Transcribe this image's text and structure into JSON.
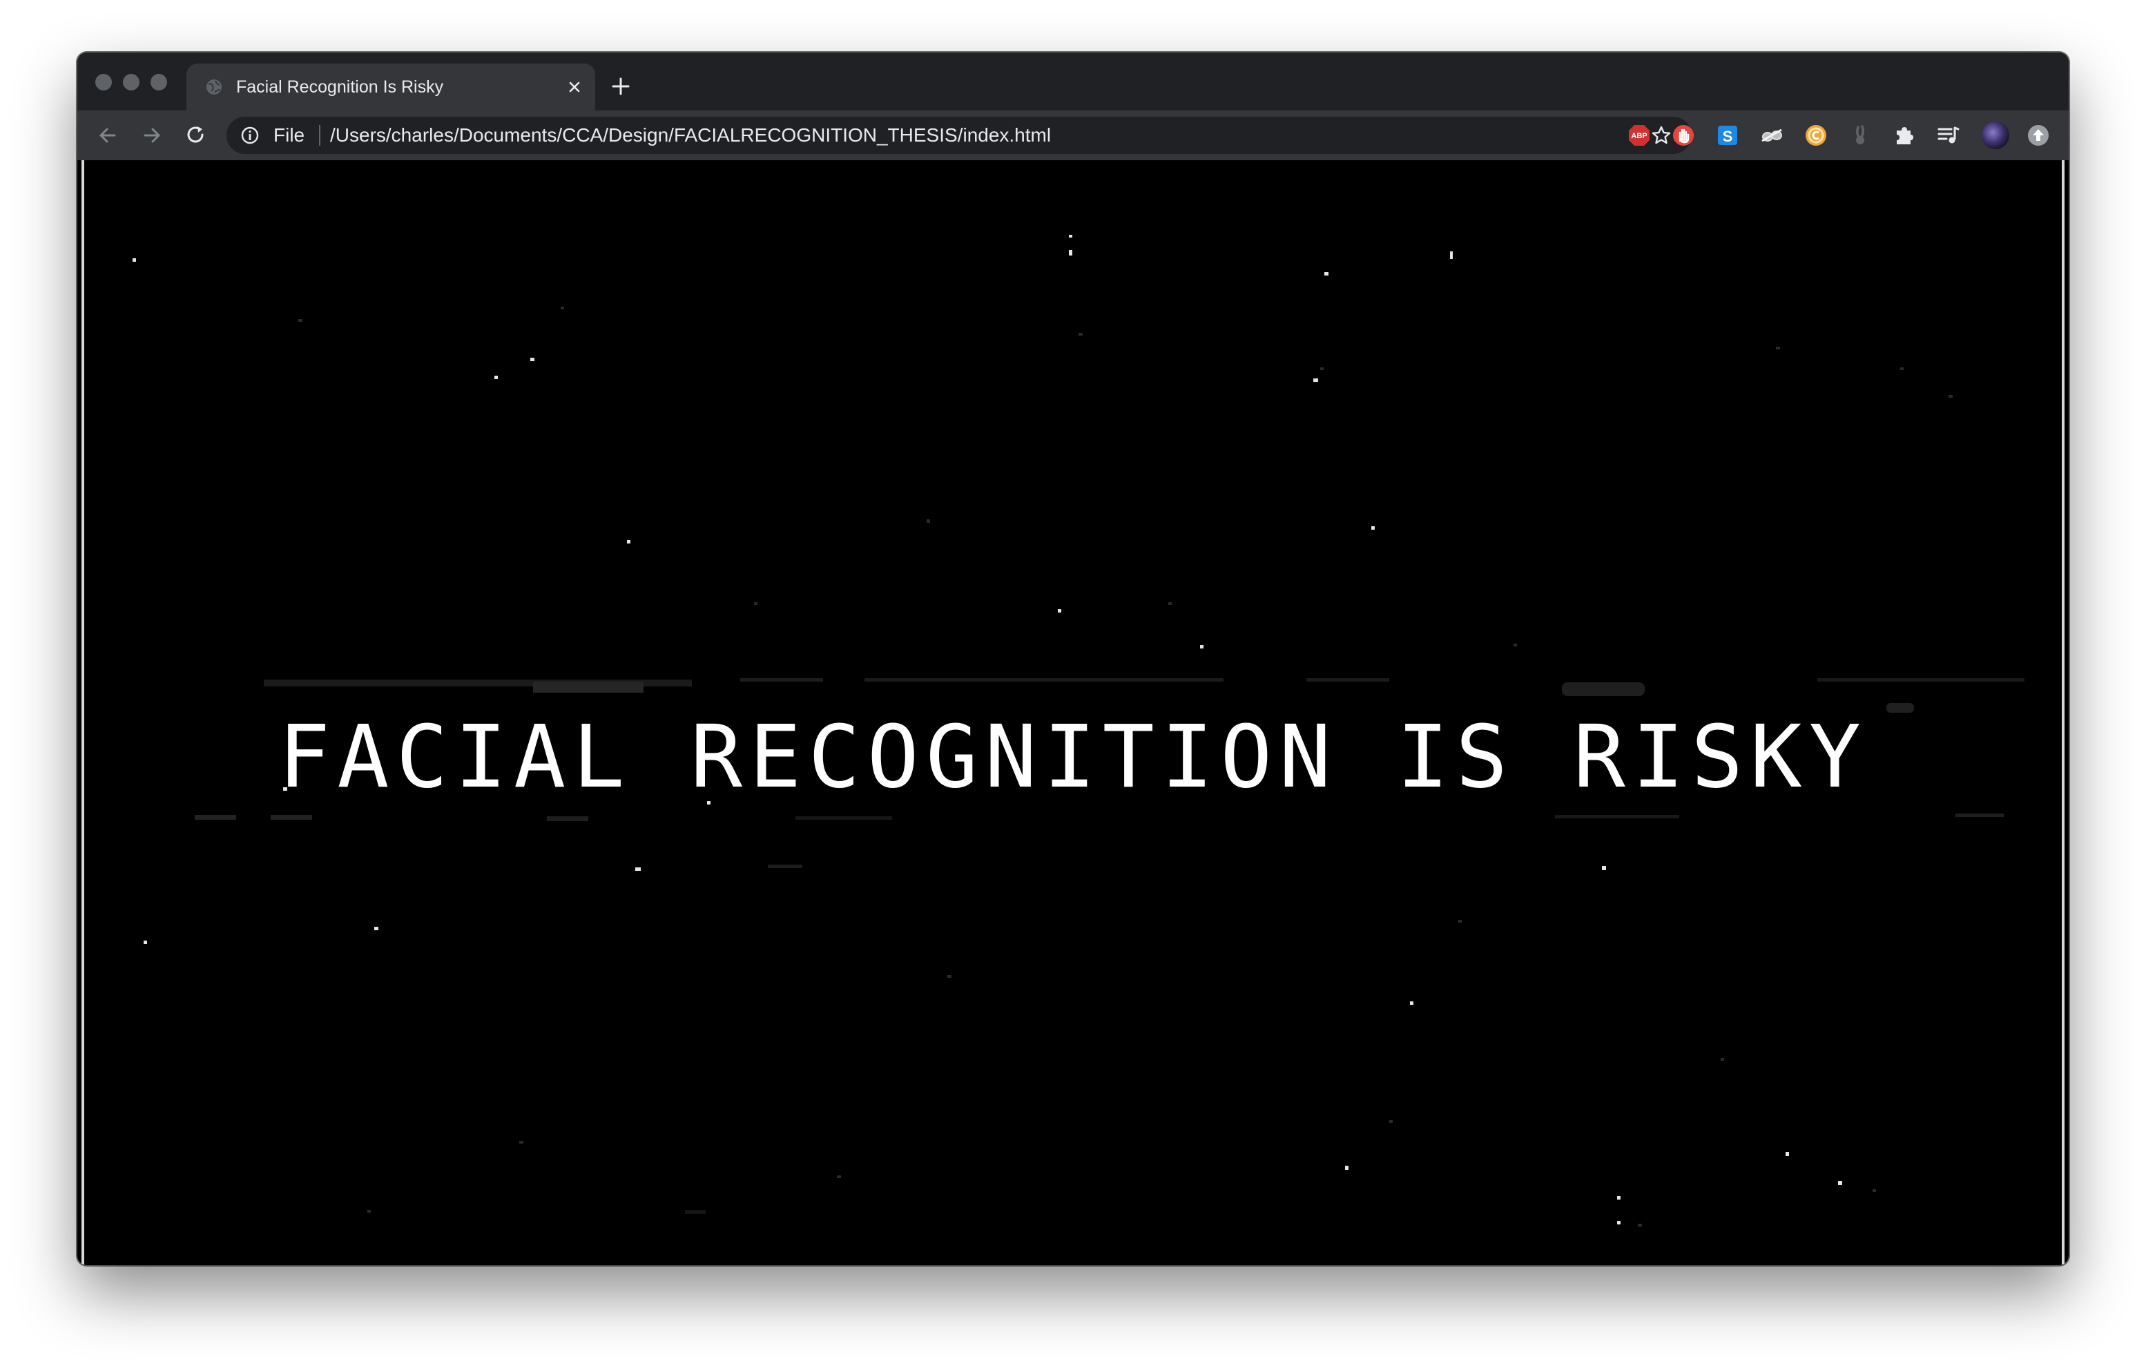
{
  "browser": {
    "tab": {
      "title": "Facial Recognition Is Risky",
      "favicon": "globe-icon"
    },
    "omnibox": {
      "scheme_label": "File",
      "url": "/Users/charles/Documents/CCA/Design/FACIALRECOGNITION_THESIS/index.html"
    },
    "extensions": [
      {
        "name": "adblock-plus-icon",
        "label": "ABP",
        "color": "#d33131"
      },
      {
        "name": "stop-hand-icon",
        "color": "#e8453c"
      },
      {
        "name": "s-extension-icon",
        "label": "S",
        "color": "#1e88e5"
      },
      {
        "name": "goggles-icon"
      },
      {
        "name": "coin-icon",
        "color": "#f0a73a"
      },
      {
        "name": "bunny-icon"
      },
      {
        "name": "puzzle-icon"
      },
      {
        "name": "media-queue-icon"
      }
    ]
  },
  "page": {
    "headline": "FACIAL RECOGNITION IS RISKY",
    "background": "#000000",
    "text_color": "#ffffff"
  }
}
